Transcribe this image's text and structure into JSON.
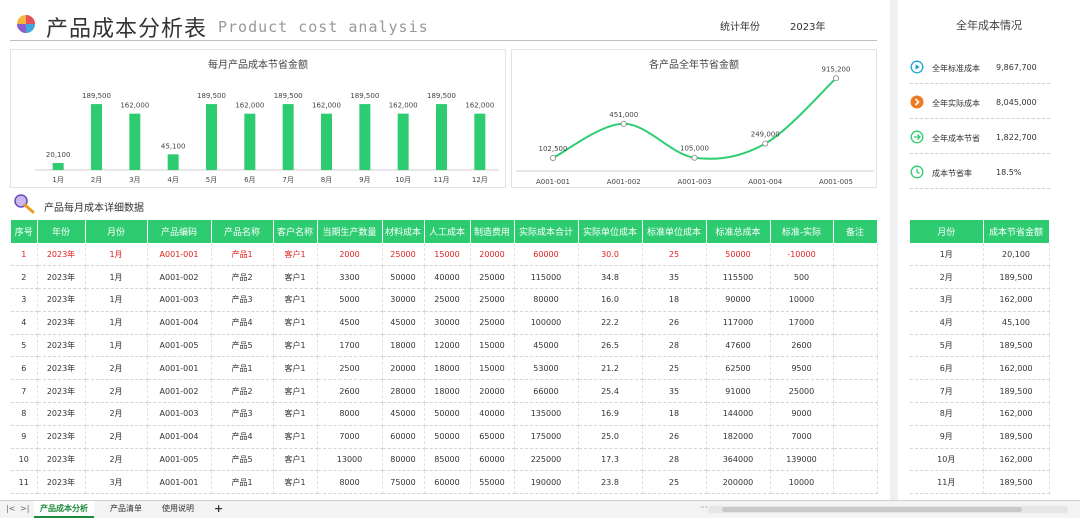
{
  "header": {
    "title_cn": "产品成本分析表",
    "title_en": "Product cost analysis",
    "year_label": "统计年份",
    "year_value": "2023年"
  },
  "colors": {
    "accent": "#2ecc71",
    "highlight": "#e02020"
  },
  "monthly_chart": {
    "chart_data": {
      "type": "bar",
      "title": "每月产品成本节省金额",
      "categories": [
        "1月",
        "2月",
        "3月",
        "4月",
        "5月",
        "6月",
        "7月",
        "8月",
        "9月",
        "10月",
        "11月",
        "12月"
      ],
      "values": [
        20100,
        189500,
        162000,
        45100,
        189500,
        162000,
        189500,
        162000,
        189500,
        162000,
        189500,
        162000
      ],
      "labels": [
        "20,100",
        "189,500",
        "162,000",
        "45,100",
        "189,500",
        "162,000",
        "189,500",
        "162,000",
        "189,500",
        "162,000",
        "189,500",
        "162,000"
      ],
      "ylim": [
        0,
        230000
      ],
      "color": "#2ecc71"
    }
  },
  "product_chart": {
    "chart_data": {
      "type": "line",
      "title": "各产品全年节省金额",
      "categories": [
        "A001-001",
        "A001-002",
        "A001-003",
        "A001-004",
        "A001-005"
      ],
      "values": [
        102500,
        451000,
        105000,
        249000,
        915200
      ],
      "labels": [
        "102,500",
        "451,000",
        "105,000",
        "249,000",
        "915,200"
      ],
      "ylim": [
        0,
        1000000
      ],
      "color": "#2ecc71"
    }
  },
  "section": {
    "title": "产品每月成本详细数据"
  },
  "table": {
    "columns": [
      "序号",
      "年份",
      "月份",
      "产品编码",
      "产品名称",
      "客户名称",
      "当期生产数量",
      "材料成本",
      "人工成本",
      "制造费用",
      "实际成本合计",
      "实际单位成本",
      "标准单位成本",
      "标准总成本",
      "标准-实际",
      "备注"
    ],
    "rows": [
      [
        "1",
        "2023年",
        "1月",
        "A001-001",
        "产品1",
        "客户1",
        "2000",
        "25000",
        "15000",
        "20000",
        "60000",
        "30.0",
        "25",
        "50000",
        "-10000",
        ""
      ],
      [
        "2",
        "2023年",
        "1月",
        "A001-002",
        "产品2",
        "客户1",
        "3300",
        "50000",
        "40000",
        "25000",
        "115000",
        "34.8",
        "35",
        "115500",
        "500",
        ""
      ],
      [
        "3",
        "2023年",
        "1月",
        "A001-003",
        "产品3",
        "客户1",
        "5000",
        "30000",
        "25000",
        "25000",
        "80000",
        "16.0",
        "18",
        "90000",
        "10000",
        ""
      ],
      [
        "4",
        "2023年",
        "1月",
        "A001-004",
        "产品4",
        "客户1",
        "4500",
        "45000",
        "30000",
        "25000",
        "100000",
        "22.2",
        "26",
        "117000",
        "17000",
        ""
      ],
      [
        "5",
        "2023年",
        "1月",
        "A001-005",
        "产品5",
        "客户1",
        "1700",
        "18000",
        "12000",
        "15000",
        "45000",
        "26.5",
        "28",
        "47600",
        "2600",
        ""
      ],
      [
        "6",
        "2023年",
        "2月",
        "A001-001",
        "产品1",
        "客户1",
        "2500",
        "20000",
        "18000",
        "15000",
        "53000",
        "21.2",
        "25",
        "62500",
        "9500",
        ""
      ],
      [
        "7",
        "2023年",
        "2月",
        "A001-002",
        "产品2",
        "客户1",
        "2600",
        "28000",
        "18000",
        "20000",
        "66000",
        "25.4",
        "35",
        "91000",
        "25000",
        ""
      ],
      [
        "8",
        "2023年",
        "2月",
        "A001-003",
        "产品3",
        "客户1",
        "8000",
        "45000",
        "50000",
        "40000",
        "135000",
        "16.9",
        "18",
        "144000",
        "9000",
        ""
      ],
      [
        "9",
        "2023年",
        "2月",
        "A001-004",
        "产品4",
        "客户1",
        "7000",
        "60000",
        "50000",
        "65000",
        "175000",
        "25.0",
        "26",
        "182000",
        "7000",
        ""
      ],
      [
        "10",
        "2023年",
        "2月",
        "A001-005",
        "产品5",
        "客户1",
        "13000",
        "80000",
        "85000",
        "60000",
        "225000",
        "17.3",
        "28",
        "364000",
        "139000",
        ""
      ],
      [
        "11",
        "2023年",
        "3月",
        "A001-001",
        "产品1",
        "客户1",
        "8000",
        "75000",
        "60000",
        "55000",
        "190000",
        "23.8",
        "25",
        "200000",
        "10000",
        ""
      ]
    ]
  },
  "sidebar": {
    "title": "全年成本情况",
    "kpis": [
      {
        "label": "全年标准成本",
        "value": "9,867,700",
        "icon": "play-circle-icon",
        "color": "#1fa3d6"
      },
      {
        "label": "全年实际成本",
        "value": "8,045,000",
        "icon": "chevron-right-circle-icon",
        "color": "#f07a20"
      },
      {
        "label": "全年成本节省",
        "value": "1,822,700",
        "icon": "arrow-right-circle-icon",
        "color": "#2ecc71"
      },
      {
        "label": "成本节省率",
        "value": "18.5%",
        "icon": "clock-icon",
        "color": "#2ecc71"
      }
    ],
    "table": {
      "columns": [
        "月份",
        "成本节省金额"
      ],
      "rows": [
        [
          "1月",
          "20,100"
        ],
        [
          "2月",
          "189,500"
        ],
        [
          "3月",
          "162,000"
        ],
        [
          "4月",
          "45,100"
        ],
        [
          "5月",
          "189,500"
        ],
        [
          "6月",
          "162,000"
        ],
        [
          "7月",
          "189,500"
        ],
        [
          "8月",
          "162,000"
        ],
        [
          "9月",
          "189,500"
        ],
        [
          "10月",
          "162,000"
        ],
        [
          "11月",
          "189,500"
        ]
      ]
    }
  },
  "tabs": {
    "items": [
      "产品成本分析",
      "产品清单",
      "使用说明"
    ],
    "active": 0,
    "add": "+",
    "nav_prev": "|<",
    "nav_next": ">|",
    "nav_more": "···"
  }
}
